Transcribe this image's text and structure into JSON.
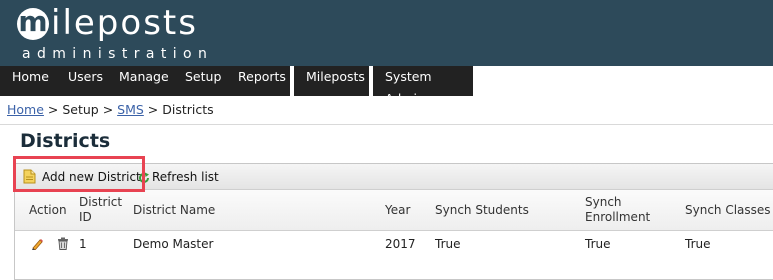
{
  "logo": {
    "initial": "m",
    "rest": "ileposts",
    "subtitle": "administration"
  },
  "nav": {
    "items": [
      {
        "label": "Home"
      },
      {
        "label": "Users"
      },
      {
        "label": "Manage"
      },
      {
        "label": "Setup"
      },
      {
        "label": "Reports"
      },
      {
        "label": "Mileposts"
      },
      {
        "label": "System Admin"
      }
    ]
  },
  "breadcrumb": {
    "home": "Home",
    "sep1": " > ",
    "setup": "Setup",
    "sep2": " > ",
    "sms": "SMS",
    "sep3": " > ",
    "current": "Districts"
  },
  "page": {
    "title": "Districts"
  },
  "toolbar": {
    "add_label": "Add new District",
    "refresh_label": "Refresh list"
  },
  "table": {
    "headers": {
      "action": "Action",
      "district_id_1": "District",
      "district_id_2": "ID",
      "name": "District Name",
      "year": "Year",
      "synch_students": "Synch Students",
      "synch_enrollment_1": "Synch",
      "synch_enrollment_2": "Enrollment",
      "synch_classes": "Synch Classes"
    },
    "rows": [
      {
        "district_id": "1",
        "name": "Demo Master",
        "year": "2017",
        "synch_students": "True",
        "synch_enrollment": "True",
        "synch_classes": "True"
      }
    ]
  },
  "colors": {
    "header_bg": "#2d4a5a",
    "nav_bg": "#222222",
    "link": "#3b62a8",
    "highlight": "#e84352"
  },
  "icons": {
    "add": "document-add-icon",
    "refresh": "refresh-icon",
    "edit": "pencil-icon",
    "delete": "trash-icon"
  }
}
